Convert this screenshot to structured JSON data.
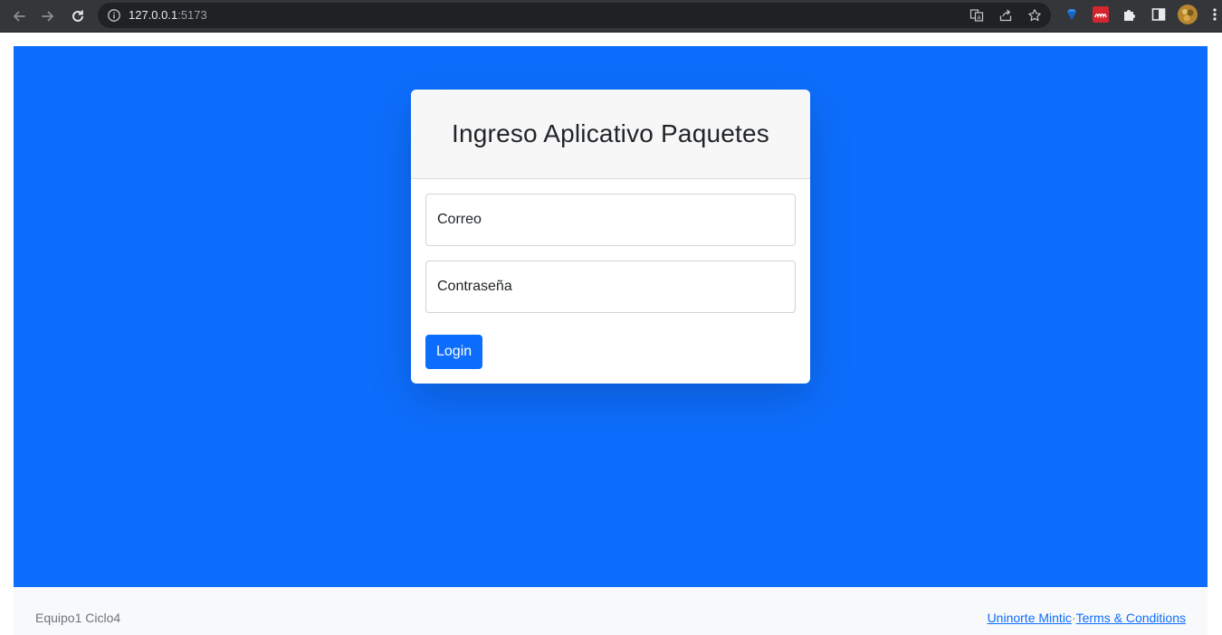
{
  "browser": {
    "url_host": "127.0.0.1",
    "url_port": ":5173"
  },
  "login_card": {
    "title": "Ingreso Aplicativo Paquetes",
    "email_placeholder": "Correo",
    "password_placeholder": "Contraseña",
    "login_label": "Login"
  },
  "footer": {
    "left_text": "Equipo1 Ciclo4",
    "link_1": "Uninorte Mintic",
    "separator": "·",
    "link_2": "Terms & Conditions"
  },
  "colors": {
    "primary": "#0d6efd",
    "card_header_bg": "#f7f7f7",
    "footer_bg": "#f8f9fa",
    "chrome_bg": "#35363a"
  },
  "icons": [
    "back-arrow-icon",
    "forward-arrow-icon",
    "reload-icon",
    "info-icon",
    "translate-icon",
    "share-icon",
    "star-icon",
    "gem-extension-icon",
    "mendeley-extension-icon",
    "puzzle-icon",
    "side-panel-icon",
    "profile-avatar",
    "kebab-menu-icon"
  ]
}
